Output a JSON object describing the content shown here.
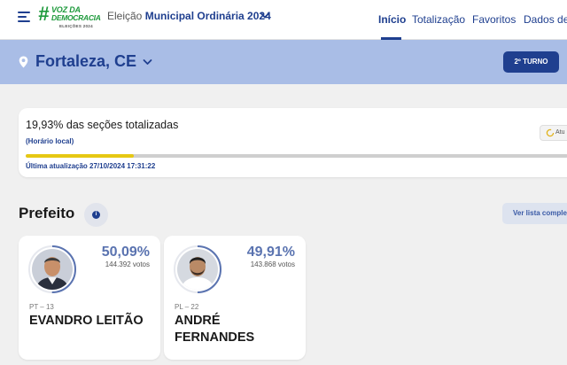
{
  "header": {
    "logo": {
      "hash": "#",
      "line1": "VOZ DA",
      "line2": "DEMOCRACIA",
      "sub": "ELEIÇÕES 2024"
    },
    "election_prefix": "Eleição",
    "election_name": "Municipal Ordinária 2024",
    "tabs": [
      {
        "label": "Início",
        "active": true
      },
      {
        "label": "Totalização",
        "active": false
      },
      {
        "label": "Favoritos",
        "active": false
      },
      {
        "label": "Dados de",
        "active": false
      }
    ]
  },
  "location": {
    "city": "Fortaleza, CE",
    "turno_button": "2º TURNO"
  },
  "progress": {
    "title": "19,93% das seções totalizadas",
    "local_time_label": "(Horário local)",
    "fraction": 0.1993,
    "last_update": "Última atualização 27/10/2024 17:31:22",
    "refresh_label": "Atu"
  },
  "section": {
    "title": "Prefeito",
    "info_symbol": "i",
    "list_button": "Ver lista comple"
  },
  "candidates": [
    {
      "percent": "50,09%",
      "votes": "144.392 votos",
      "party": "PT – 13",
      "name": "EVANDRO LEITÃO",
      "share": 0.5009
    },
    {
      "percent": "49,91%",
      "votes": "143.868 votos",
      "party": "PL – 22",
      "name": "ANDRÉ FERNANDES",
      "share": 0.4991
    }
  ],
  "colors": {
    "primary": "#1f3f8f",
    "location_bar": "#a9bde6",
    "progress_fill": "#e6c813",
    "logo_green": "#1e9a3c",
    "percent_text": "#5a73b0"
  }
}
